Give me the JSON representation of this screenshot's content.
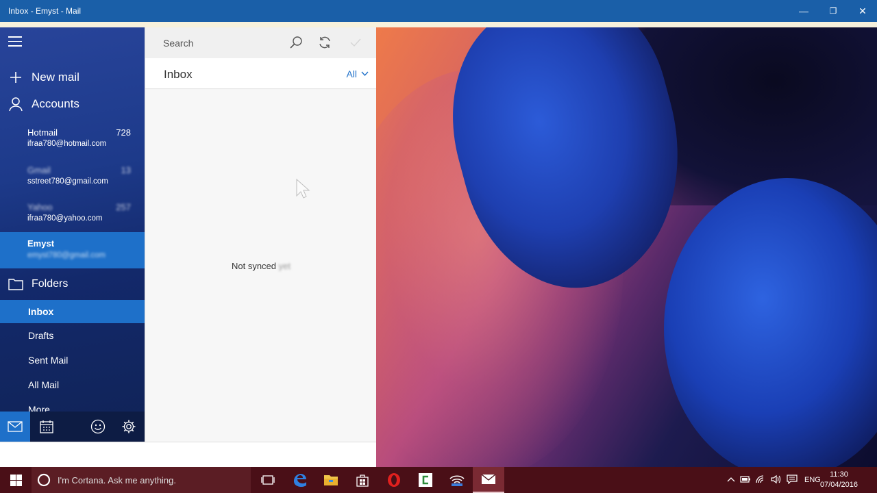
{
  "window": {
    "title": "Inbox - Emyst - Mail",
    "minimize": "—",
    "maximize": "❐",
    "close": "✕"
  },
  "sidebar": {
    "new_mail": "New mail",
    "accounts_label": "Accounts",
    "accounts": [
      {
        "name": "Hotmail",
        "count": "728",
        "email": "ifraa780@hotmail.com",
        "blurred_name": false
      },
      {
        "name": "Gmail",
        "count": "13",
        "email": "sstreet780@gmail.com",
        "blurred_name": true
      },
      {
        "name": "Yahoo",
        "count": "257",
        "email": "ifraa780@yahoo.com",
        "blurred_name": true
      },
      {
        "name": "Emyst",
        "count": "",
        "email": "emyst780@gmail.com",
        "selected": true
      }
    ],
    "folders_label": "Folders",
    "folders": [
      "Inbox",
      "Drafts",
      "Sent Mail",
      "All Mail",
      "More"
    ],
    "bottom_icons": [
      "mail-icon",
      "calendar-icon",
      "feedback-smiley-icon",
      "settings-gear-icon"
    ]
  },
  "message_list": {
    "search_placeholder": "Search",
    "folder_title": "Inbox",
    "filter": "All",
    "empty_text": "Not synced",
    "empty_text_blurred": "yet"
  },
  "taskbar": {
    "cortana_placeholder": "I'm Cortana. Ask me anything.",
    "language": "ENG",
    "time": "11:30",
    "date": "07/04/2016",
    "accent": "#4a0f17"
  },
  "colors": {
    "titlebar": "#1a5fa8",
    "selection": "#1e70c9",
    "link": "#1e70c9"
  }
}
